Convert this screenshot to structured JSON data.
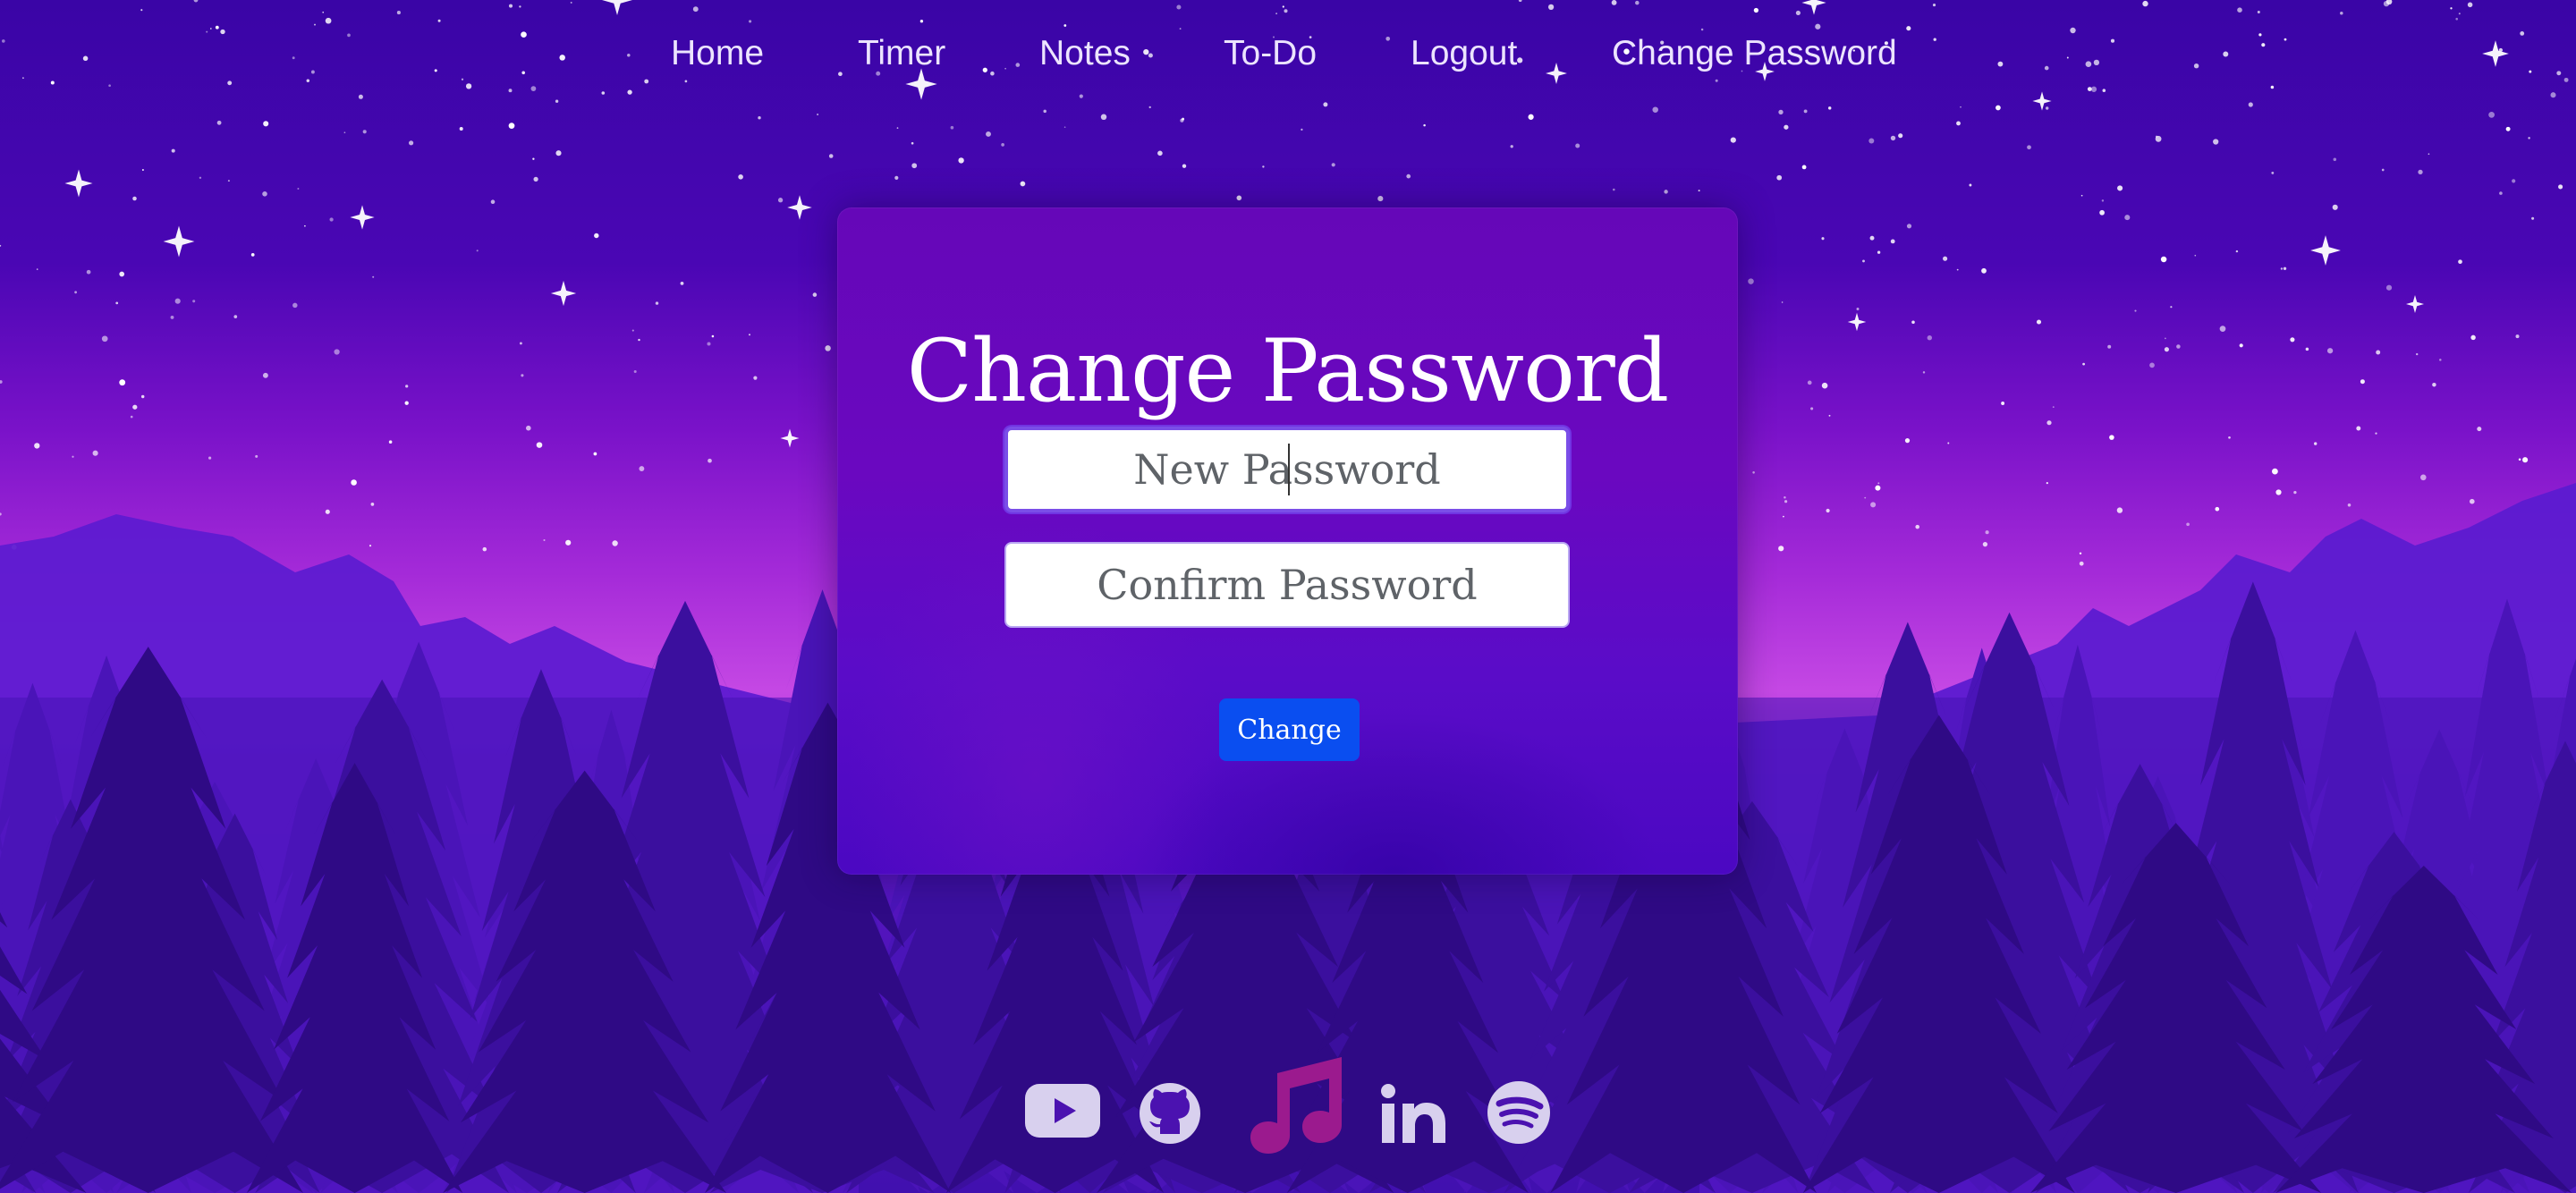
{
  "nav": {
    "items": [
      {
        "label": "Home"
      },
      {
        "label": "Timer"
      },
      {
        "label": "Notes"
      },
      {
        "label": "To-Do"
      },
      {
        "label": "Logout"
      },
      {
        "label": "Change Password"
      }
    ]
  },
  "card": {
    "title": "Change Password",
    "new_password": {
      "placeholder": "New Password",
      "value": ""
    },
    "confirm_password": {
      "placeholder": "Confirm Password",
      "value": ""
    },
    "button_label": "Change"
  },
  "social": {
    "icons": [
      "youtube-icon",
      "github-icon",
      "music-note-icon",
      "linkedin-icon",
      "spotify-icon"
    ]
  },
  "colors": {
    "sky_top": "#3a05a6",
    "sky_horizon": "#b43be0",
    "card_bg": "#6507b8",
    "button": "#0a4ef0",
    "music_icon": "#9b1a8e",
    "social_icon": "#d8d0ee"
  }
}
